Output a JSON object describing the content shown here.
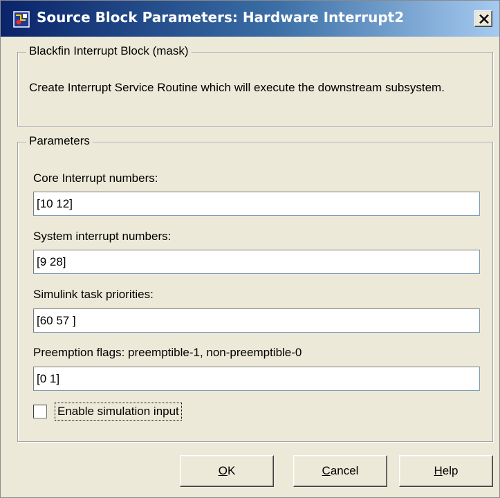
{
  "window": {
    "title": "Source Block Parameters: Hardware Interrupt2",
    "icon": "simulink-block-icon",
    "close_icon": "close-icon"
  },
  "description_group": {
    "legend": "Blackfin Interrupt Block (mask)",
    "text": "Create Interrupt Service Routine which will execute the downstream subsystem."
  },
  "parameters_group": {
    "legend": "Parameters",
    "fields": [
      {
        "label": "Core Interrupt numbers:",
        "value": "[10 12]"
      },
      {
        "label": "System interrupt numbers:",
        "value": "[9 28]"
      },
      {
        "label": "Simulink task priorities:",
        "value": "[60 57 ]"
      },
      {
        "label": "Preemption flags: preemptible-1, non-preemptible-0",
        "value": "[0 1]"
      }
    ],
    "checkbox": {
      "label": "Enable simulation input",
      "checked": false
    }
  },
  "buttons": {
    "ok": {
      "mnemonic": "O",
      "rest": "K"
    },
    "cancel": {
      "mnemonic": "C",
      "rest": "ancel"
    },
    "help": {
      "mnemonic": "H",
      "rest": "elp"
    }
  }
}
